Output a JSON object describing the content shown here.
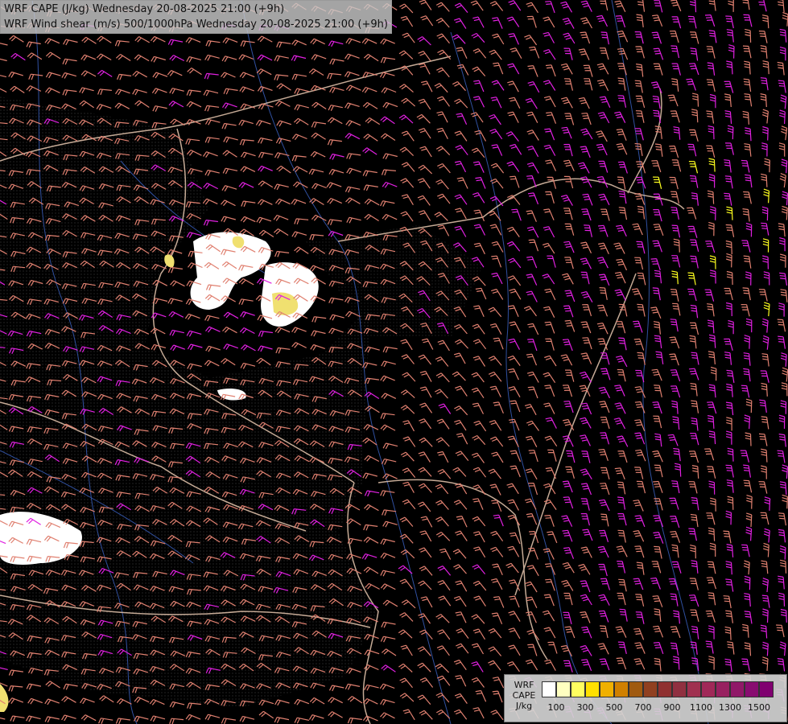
{
  "titles": {
    "line1": "WRF CAPE (J/kg) Wednesday 20-08-2025 21:00 (+9h)",
    "line2": "WRF Wind shear (m/s) 500/1000hPa Wednesday 20-08-2025 21:00 (+9h)"
  },
  "legend": {
    "label_line1": "WRF",
    "label_line2": "CAPE",
    "label_line3": "J/kg",
    "colors": [
      "#ffffff",
      "#ffffc0",
      "#ffff60",
      "#ffe000",
      "#f0b000",
      "#d08000",
      "#a05a10",
      "#904020",
      "#903030",
      "#903040",
      "#a03050",
      "#a02858",
      "#982060",
      "#901868",
      "#880c70",
      "#800070"
    ],
    "ticks": [
      "100",
      "300",
      "500",
      "700",
      "900",
      "1100",
      "1300",
      "1500"
    ]
  },
  "map_colors": {
    "background": "#000000",
    "barb_salmon": "#e08070",
    "barb_magenta": "#e020e0",
    "barb_yellow": "#ffff20",
    "border": "#e8c8b0",
    "river": "#3050a0",
    "cape_low": "#ffffff",
    "cape_mid": "#f0e070"
  }
}
